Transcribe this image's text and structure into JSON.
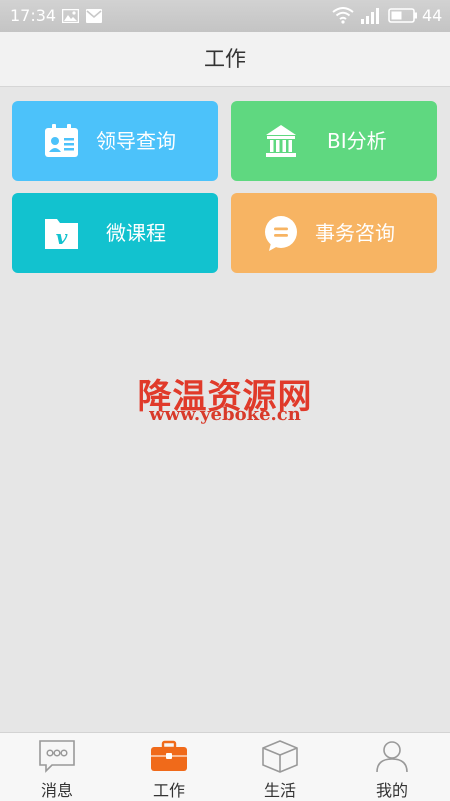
{
  "status_bar": {
    "time": "17:34",
    "battery": "44"
  },
  "header": {
    "title": "工作"
  },
  "tiles": [
    {
      "label": "领导查询",
      "icon": "contact-card-icon",
      "color": "#4cc2fa"
    },
    {
      "label": "BI分析",
      "icon": "bank-building-icon",
      "color": "#5fd880"
    },
    {
      "label": "微课程",
      "icon": "folder-v-icon",
      "color": "#12c2cf"
    },
    {
      "label": "事务咨询",
      "icon": "chat-bubble-icon",
      "color": "#f7b463"
    }
  ],
  "watermark": {
    "title": "降温资源网",
    "url": "www.yeboke.cn"
  },
  "tabbar": {
    "active_color": "#f06a1a",
    "items": [
      {
        "label": "消息",
        "icon": "message-icon"
      },
      {
        "label": "工作",
        "icon": "briefcase-icon",
        "active": true
      },
      {
        "label": "生活",
        "icon": "box-icon"
      },
      {
        "label": "我的",
        "icon": "person-icon"
      }
    ]
  }
}
